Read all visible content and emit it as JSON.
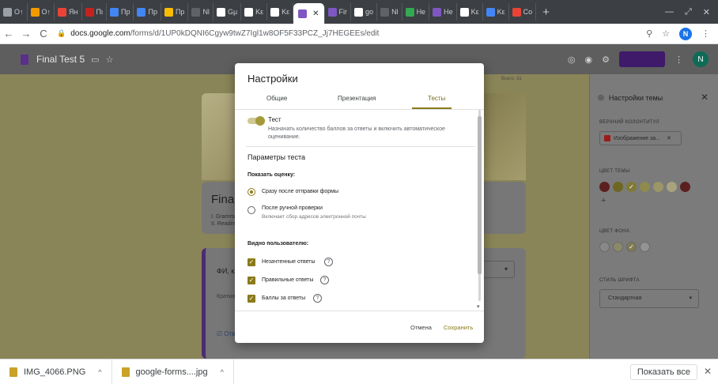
{
  "browser": {
    "tabs": [
      {
        "label": "О↑",
        "color": "#9aa0a6"
      },
      {
        "label": "О↑",
        "color": "#f29900"
      },
      {
        "label": "Ян",
        "color": "#ea4335"
      },
      {
        "label": "Пι",
        "color": "#c5221f"
      },
      {
        "label": "Пр",
        "color": "#4285f4"
      },
      {
        "label": "Пр",
        "color": "#4285f4"
      },
      {
        "label": "Пр",
        "color": "#fbbc04"
      },
      {
        "label": "Nl",
        "color": "#5f6368"
      },
      {
        "label": "Gμ",
        "color": "#ffffff"
      },
      {
        "label": "Kε",
        "color": "#ffffff"
      },
      {
        "label": "Kε",
        "color": "#ffffff"
      }
    ],
    "active_tab_color": "#7e57c2",
    "tabs_after": [
      {
        "label": "Fir",
        "color": "#7e57c2"
      },
      {
        "label": "go",
        "color": "#ffffff"
      },
      {
        "label": "Nl",
        "color": "#5f6368"
      },
      {
        "label": "He",
        "color": "#34a853"
      },
      {
        "label": "He",
        "color": "#7e57c2"
      },
      {
        "label": "Kε",
        "color": "#ffffff"
      },
      {
        "label": "Kε",
        "color": "#4285f4"
      },
      {
        "label": "Co",
        "color": "#ea4335"
      }
    ],
    "url_host": "docs.google.com",
    "url_path": "/forms/d/1UP0kDQNI6Cgyw9twZ7Igl1w8OF5F33PCZ_Jj7HEGEEs/edit",
    "profile_initial": "N"
  },
  "forms": {
    "doc_title": "Final Test 5",
    "avatar_initial": "N",
    "total_label": "Всего: 31",
    "title_card_title": "Final",
    "title_card_lines": [
      "I. Gramma",
      "II. Readin"
    ],
    "question_title": "ФИ, кл",
    "question_short": "Краткий о",
    "question_answer": "Отв"
  },
  "theme": {
    "title": "Настройки темы",
    "header_label": "ВЕРХНИЙ КОЛОНТИТУЛ",
    "header_chip": "Изображение за...",
    "color_label": "ЦВЕТ ТЕМЫ",
    "theme_colors": [
      "#5c1f1f",
      "#6d6722",
      "#817a36",
      "#8f8a4e",
      "#9b9668",
      "#a8a37e",
      "#5c1f1f"
    ],
    "bg_label": "ЦВЕТ ФОНА",
    "bg_colors": [
      "#888888",
      "#8c8968",
      "#7f7b52",
      "#939393"
    ],
    "font_label": "СТИЛЬ ШРИФТА",
    "font_value": "Стандартная"
  },
  "dialog": {
    "title": "Настройки",
    "tabs": [
      "Общие",
      "Презентация",
      "Тесты"
    ],
    "test_label": "Тест",
    "test_desc": "Назначать количество баллов за ответы и включить автоматическое оценивание.",
    "params_title": "Параметры теста",
    "show_grade_label": "Показать оценку:",
    "radio_immediately": "Сразу после отправки формы",
    "radio_after_review": "После ручной проверки",
    "radio_after_review_sub": "Включает сбор адресов электронной почты",
    "visible_label": "Видно пользователю:",
    "checkbox_missed": "Незачтенные ответы",
    "checkbox_correct": "Правильные ответы",
    "checkbox_points": "Баллы за ответы",
    "cancel": "Отмена",
    "save": "Сохранить"
  },
  "downloads": {
    "items": [
      "IMG_4066.PNG",
      "google-forms....jpg"
    ],
    "show_all": "Показать все"
  },
  "colors": {
    "accent": "#8a7a1a",
    "purple": "#4a2c73"
  }
}
